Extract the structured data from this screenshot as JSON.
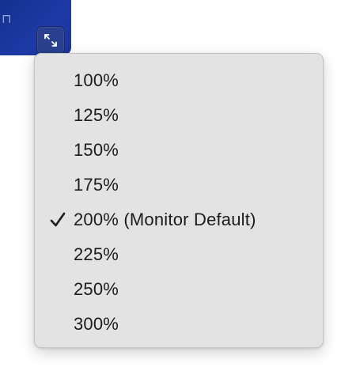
{
  "app": {
    "tile_glyph": "⊓",
    "resize_icon": "expand-arrows-icon"
  },
  "menu": {
    "items": [
      {
        "label": "100%",
        "checked": false
      },
      {
        "label": "125%",
        "checked": false
      },
      {
        "label": "150%",
        "checked": false
      },
      {
        "label": "175%",
        "checked": false
      },
      {
        "label": "200% (Monitor Default)",
        "checked": true
      },
      {
        "label": "225%",
        "checked": false
      },
      {
        "label": "250%",
        "checked": false
      },
      {
        "label": "300%",
        "checked": false
      }
    ],
    "check_icon": "checkmark-icon"
  },
  "colors": {
    "tile_blue": "#1d3aa6",
    "menu_bg": "#e3e3e3",
    "text": "#1c1c1c"
  }
}
